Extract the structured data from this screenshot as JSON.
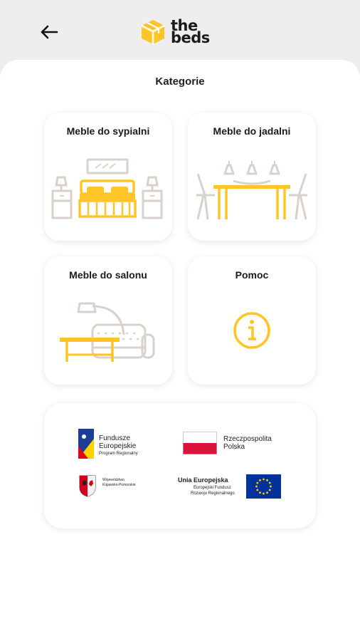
{
  "brand": {
    "line1": "the",
    "line2": "beds"
  },
  "header": {
    "back_icon": "arrow-left-icon"
  },
  "title": "Kategorie",
  "categories": [
    {
      "label": "Meble do sypialni",
      "icon": "bedroom-furniture-illustration"
    },
    {
      "label": "Meble do jadalni",
      "icon": "dining-furniture-illustration"
    },
    {
      "label": "Meble do salonu",
      "icon": "living-room-furniture-illustration"
    },
    {
      "label": "Pomoc",
      "icon": "info-icon"
    }
  ],
  "partners": {
    "fe": {
      "line1": "Fundusze",
      "line2": "Europejskie",
      "line3": "Program Regionalny"
    },
    "rp": {
      "line1": "Rzeczpospolita",
      "line2": "Polska"
    },
    "woj": {
      "line1": "Województwo",
      "line2": "Kujawsko-Pomorskie"
    },
    "ue": {
      "line1": "Unia Europejska",
      "line2": "Europejski Fundusz",
      "line3": "Rozwoju Regionalnego"
    }
  },
  "colors": {
    "accent": "#ffc526",
    "outline": "#d8d2cb",
    "background": "#eeeeee",
    "card": "#ffffff"
  }
}
